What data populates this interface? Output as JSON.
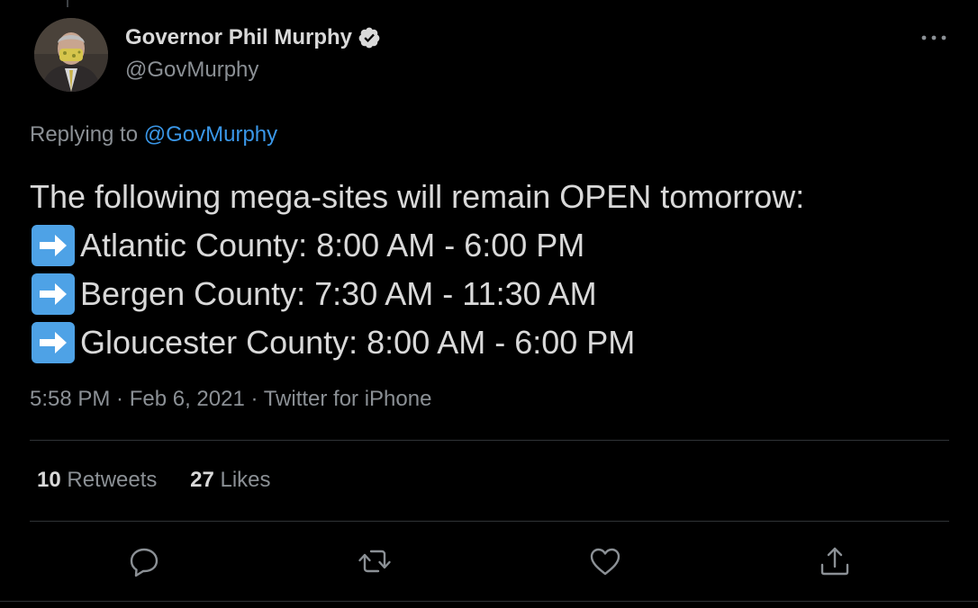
{
  "author": {
    "display_name": "Governor Phil Murphy",
    "handle": "@GovMurphy",
    "verified": true,
    "avatar_icon": "profile-photo"
  },
  "reply": {
    "prefix": "Replying to",
    "mention": "@GovMurphy"
  },
  "tweet": {
    "lines": [
      {
        "emoji": "",
        "text": "The following mega-sites will remain OPEN tomorrow:"
      },
      {
        "emoji": "right-arrow-emoji",
        "text": "Atlantic County: 8:00 AM - 6:00 PM"
      },
      {
        "emoji": "right-arrow-emoji",
        "text": "Bergen County: 7:30 AM - 11:30 AM"
      },
      {
        "emoji": "right-arrow-emoji",
        "text": "Gloucester County: 8:00 AM - 6:00 PM"
      }
    ]
  },
  "meta": {
    "text": "5:58 PM · Feb 6, 2021 · Twitter for iPhone"
  },
  "stats": {
    "retweets_count": "10",
    "retweets_label": "Retweets",
    "likes_count": "27",
    "likes_label": "Likes"
  },
  "actions": [
    "reply-icon",
    "retweet-icon",
    "like-icon",
    "share-icon"
  ],
  "colors": {
    "background": "#000000",
    "text_primary": "#d9d9d9",
    "text_secondary": "#8b9095",
    "link": "#3a97e8",
    "divider": "#2f3336"
  }
}
